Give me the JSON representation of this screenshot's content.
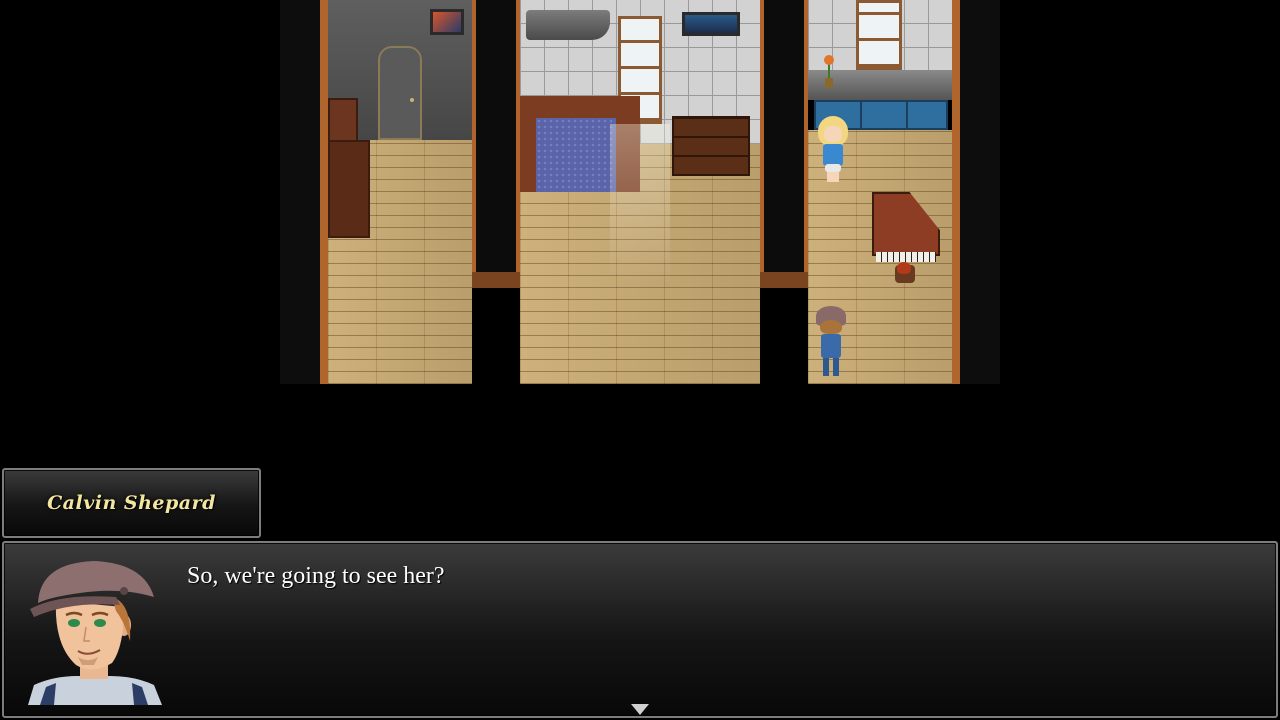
{
  "dialogue": {
    "speaker": "Calvin Shepard",
    "message": "So, we're going to see her?",
    "continue_icon": "triangle-down-icon"
  },
  "scene": {
    "type": "top-down RPG interior",
    "rooms": [
      "hallway",
      "bedroom",
      "kitchen"
    ],
    "characters": [
      "player-boy-cap",
      "blonde-girl",
      "child-at-piano"
    ]
  },
  "colors": {
    "speaker_name": "#f3e6a0",
    "message_text": "#ffffff",
    "panel_border": "#7d7d7d"
  }
}
